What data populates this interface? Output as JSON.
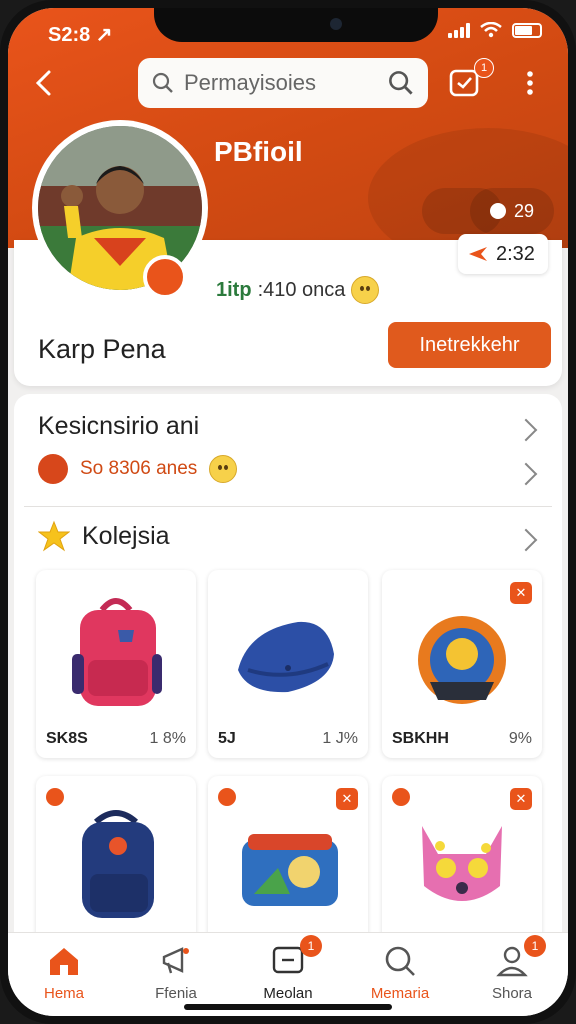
{
  "status": {
    "time": "S2:8 ↗"
  },
  "header": {
    "search_placeholder": "Permayisoies",
    "message_badge": "1",
    "profile_title": "PBfioil",
    "pill_value": "29",
    "timer": "2:32"
  },
  "profile": {
    "stats_green": "1itp",
    "stats_text": ":410 onca",
    "name": "Karp Pena",
    "action_label": "Inetrekkehr"
  },
  "activity": {
    "title": "Kesicnsirio ani",
    "subtitle": "So 8306 anes"
  },
  "collection": {
    "title": "Kolejsia",
    "items": [
      {
        "left": "SK8S",
        "right": "1 8%",
        "tag": ""
      },
      {
        "left": "5J",
        "right": "1 J%",
        "tag": ""
      },
      {
        "left": "SBKHH",
        "right": "9%",
        "tag": "✕"
      },
      {
        "left": "",
        "right": "",
        "tag": "✕"
      },
      {
        "left": "",
        "right": "",
        "tag": "✕"
      },
      {
        "left": "",
        "right": "",
        "tag": "✕"
      }
    ]
  },
  "nav": [
    {
      "label": "Hema",
      "icon": "home-icon",
      "badge": ""
    },
    {
      "label": "Ffenia",
      "icon": "megaphone-icon",
      "badge": ""
    },
    {
      "label": "Meolan",
      "icon": "chat-icon",
      "badge": "1"
    },
    {
      "label": "Memaria",
      "icon": "search-icon",
      "badge": ""
    },
    {
      "label": "Shora",
      "icon": "user-icon",
      "badge": "1"
    }
  ],
  "colors": {
    "accent": "#e9541b",
    "accent_dark": "#c04412"
  }
}
